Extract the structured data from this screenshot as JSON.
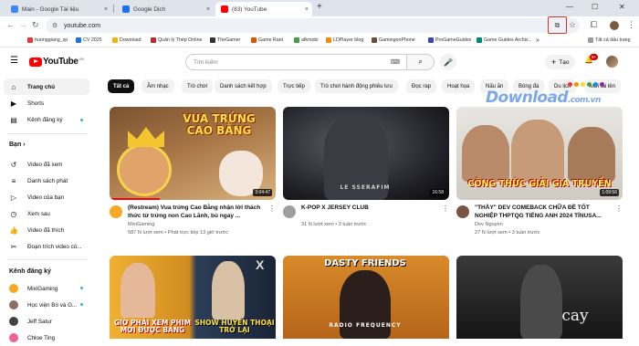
{
  "browser": {
    "tabs": [
      {
        "title": "Main - Google Tài liệu",
        "close": "×"
      },
      {
        "title": "Google Dịch",
        "close": "×"
      },
      {
        "title": "(83) YouTube",
        "close": "×"
      }
    ],
    "new_tab": "+",
    "url": "youtube.com",
    "bookmarks": [
      "huonggiang_sp",
      "CV 2025",
      "Download",
      "Quản lý Thép Online",
      "TheGamer",
      "Game Rant",
      "afkmobi",
      "LDPlayer blog",
      "GamingonPhone",
      "ProGameGuides",
      "Game Guides Archiv..."
    ],
    "bookmarks_more": "»",
    "all_bookmarks": "Tất cả dấu trang"
  },
  "youtube": {
    "logo_text": "YouTube",
    "country": "VN",
    "search_placeholder": "Tìm kiếm",
    "create_label": "Tạo",
    "notif_count": "9+",
    "sidebar": {
      "main": [
        {
          "label": "Trang chủ"
        },
        {
          "label": "Shorts"
        },
        {
          "label": "Kênh đăng ký"
        }
      ],
      "you_header": "Bạn",
      "you_header_chev": "›",
      "you": [
        {
          "label": "Video đã xem"
        },
        {
          "label": "Danh sách phát"
        },
        {
          "label": "Video của bạn"
        },
        {
          "label": "Xem sau"
        },
        {
          "label": "Video đã thích"
        },
        {
          "label": "Đoạn trích video củ..."
        }
      ],
      "subs_header": "Kênh đăng ký",
      "subs": [
        {
          "label": "MixiGaming"
        },
        {
          "label": "Học viện Bò và G..."
        },
        {
          "label": "Jeff Satur"
        },
        {
          "label": "Chloe Ting"
        }
      ]
    },
    "chips": [
      "Tất cả",
      "Âm nhạc",
      "Trò chơi",
      "Danh sách kết hợp",
      "Trực tiếp",
      "Trò chơi hành động phiêu lưu",
      "Đọc rap",
      "Hoạt họa",
      "Nấu ăn",
      "Bóng đá",
      "Du lịch",
      "Mới tải lên"
    ],
    "videos": [
      {
        "title": "(Restream) Vua trứng Cao Bằng nhận lời thách thức từ trứng non Cao Lãnh, bù ngay ...",
        "channel": "MixiGaming",
        "stats": "587 N lượt xem • Phát trực tiếp 13 giờ trước",
        "duration": "3:04:47",
        "thumb_text": "VUA TRỨNG CAO BẰNG",
        "progress": 0.3
      },
      {
        "title": "K-POP X JERSEY CLUB",
        "channel": "",
        "stats": "31 N lượt xem • 3 tuần trước",
        "duration": "16:58",
        "thumb_text": "LE SSERAFIM",
        "progress": 0
      },
      {
        "title": "\"THẦY\" DEV COMEBACK CHỮA ĐỀ TỐT NGHIỆP THPTQG TIẾNG ANH 2024 TÍNUSA...",
        "channel": "Dev Nguyen",
        "stats": "27 N lượt xem • 3 tuần trước",
        "duration": "1:09:56",
        "thumb_text": "CÔNG THỨC GIẢI GIA TRUYỀN",
        "progress": 0
      },
      {
        "title": "",
        "channel": "",
        "stats": "",
        "duration": "",
        "thumb_text": "GIỜ PHẢI XEM PHIM MỚI ĐƯỢC BÁNG",
        "thumb_text2": "SHOW HUYỀN THOẠI TRỞ LẠI",
        "thumb_letter": "X"
      },
      {
        "title": "",
        "channel": "",
        "stats": "",
        "duration": "",
        "thumb_text": "DASTY FRIENDS",
        "thumb_text2": "RADIO FREQUENCY"
      },
      {
        "title": "",
        "channel": "",
        "stats": "",
        "duration": "",
        "thumb_text": "cay"
      }
    ],
    "watermark": "Download",
    "watermark_tld": ".com.vn"
  },
  "colors": {
    "accent": "#ff0000",
    "highlight_box": "#d93025",
    "dot_blue": "#3ea6ff"
  }
}
